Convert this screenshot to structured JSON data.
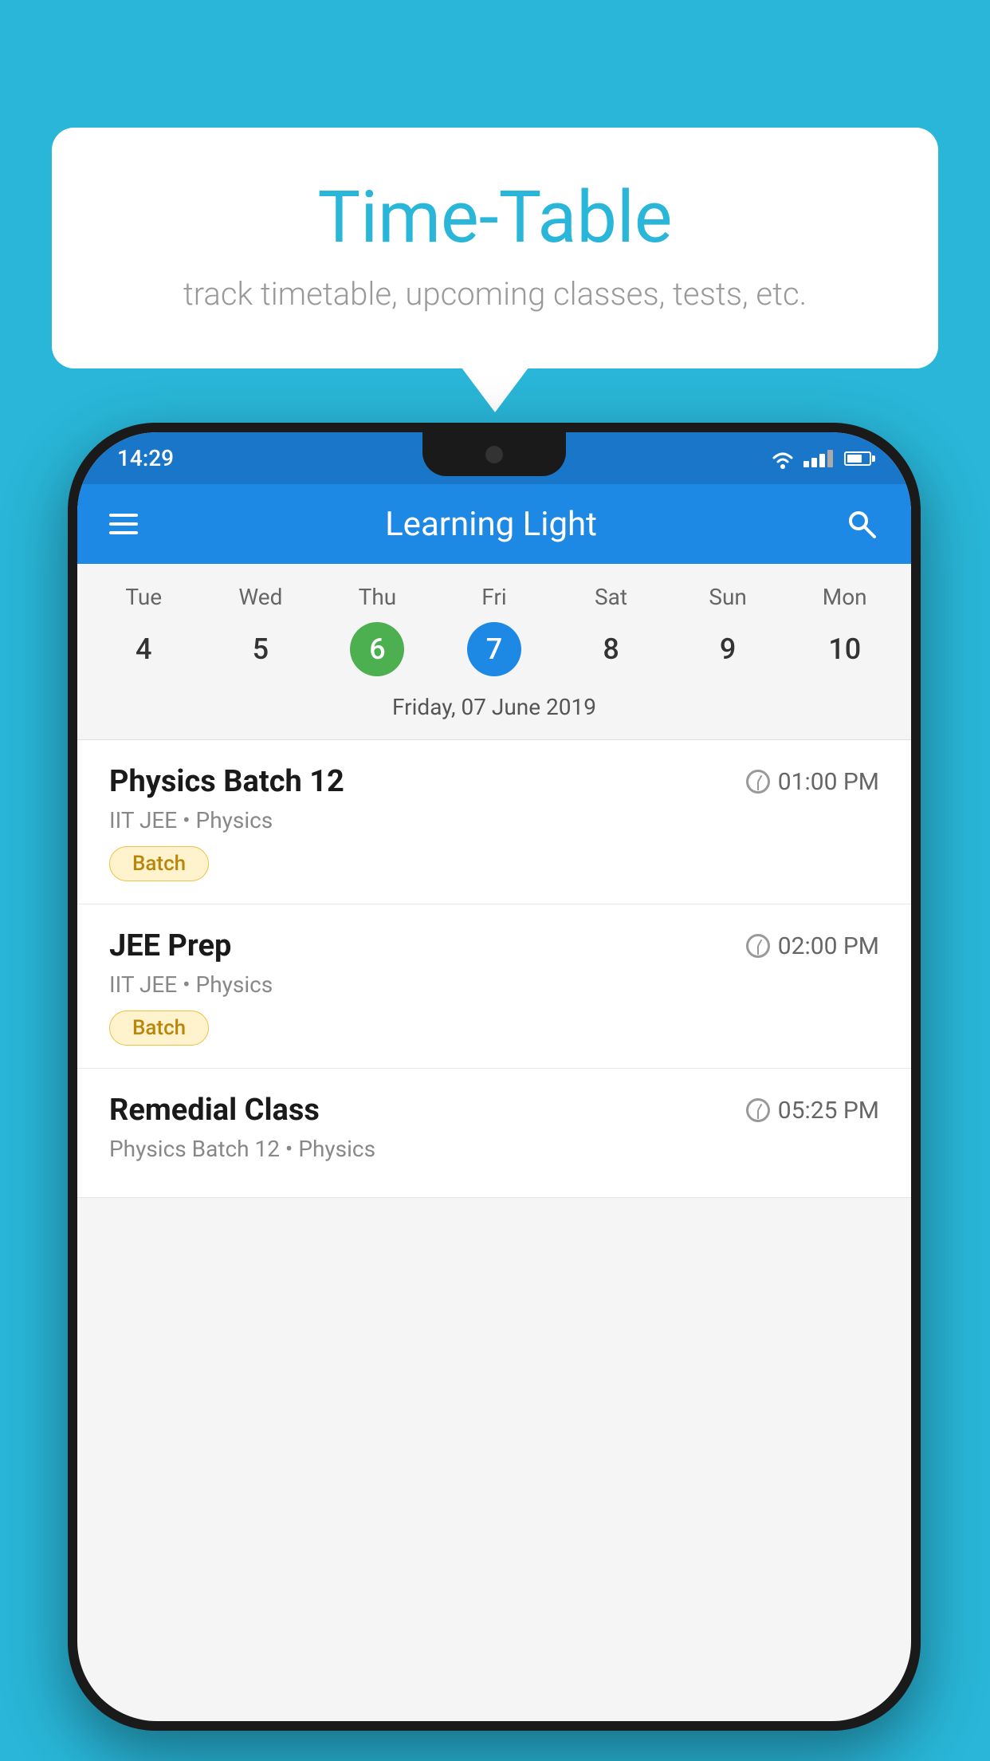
{
  "background_color": "#29b6d8",
  "bubble": {
    "title": "Time-Table",
    "subtitle": "track timetable, upcoming classes, tests, etc."
  },
  "phone": {
    "status_bar": {
      "time": "14:29"
    },
    "app_bar": {
      "title": "Learning Light"
    },
    "calendar": {
      "days": [
        "Tue",
        "Wed",
        "Thu",
        "Fri",
        "Sat",
        "Sun",
        "Mon"
      ],
      "dates": [
        "4",
        "5",
        "6",
        "7",
        "8",
        "9",
        "10"
      ],
      "today_index": 2,
      "selected_index": 3,
      "selected_label": "Friday, 07 June 2019"
    },
    "schedule": [
      {
        "title": "Physics Batch 12",
        "time": "01:00 PM",
        "meta": "IIT JEE • Physics",
        "badge": "Batch"
      },
      {
        "title": "JEE Prep",
        "time": "02:00 PM",
        "meta": "IIT JEE • Physics",
        "badge": "Batch"
      },
      {
        "title": "Remedial Class",
        "time": "05:25 PM",
        "meta": "Physics Batch 12 • Physics",
        "badge": ""
      }
    ]
  }
}
